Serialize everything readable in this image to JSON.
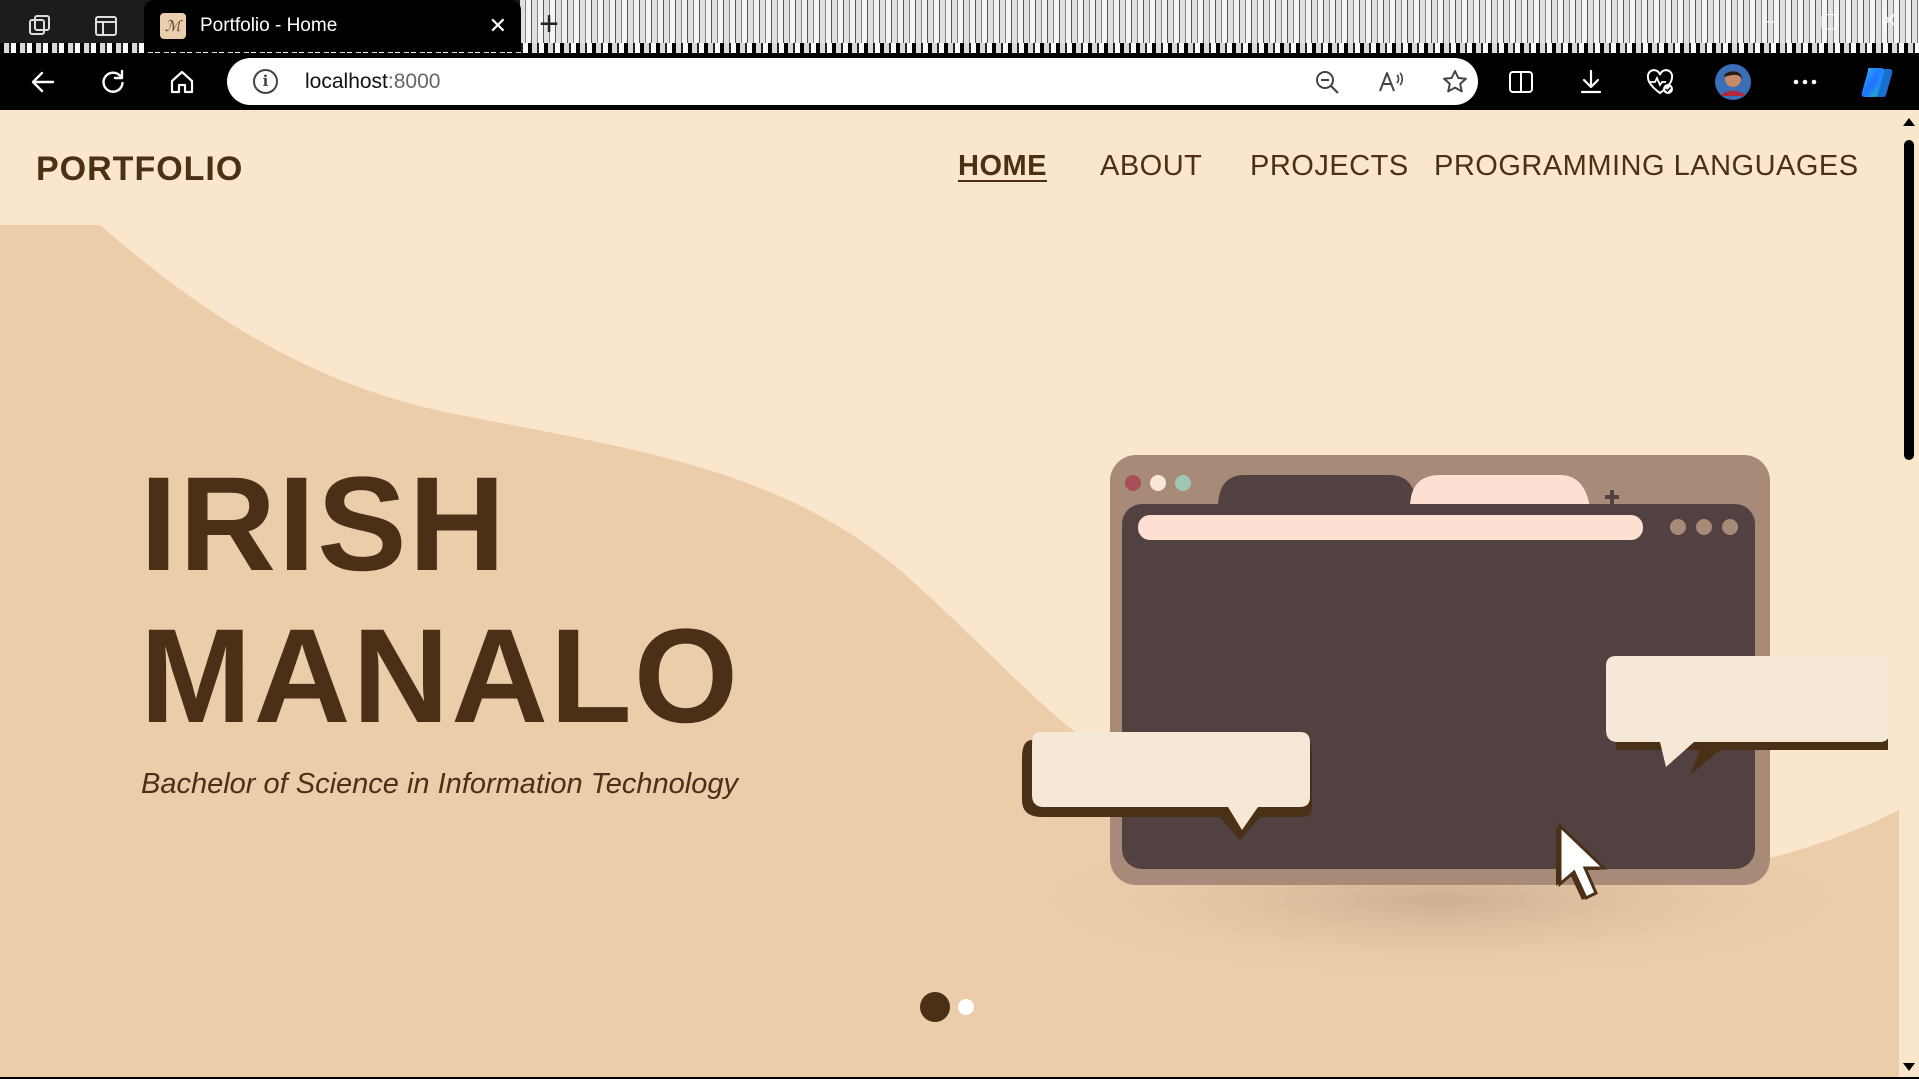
{
  "browser": {
    "tab": {
      "title": "Portfolio - Home",
      "favicon_text": "ℳ"
    },
    "address": {
      "host": "localhost",
      "port": ":8000"
    }
  },
  "site": {
    "logo": "PORTFOLIO",
    "nav": [
      {
        "label": "HOME",
        "active": true
      },
      {
        "label": "ABOUT",
        "active": false
      },
      {
        "label": "PROJECTS",
        "active": false
      },
      {
        "label": "PROGRAMMING LANGUAGES",
        "active": false
      }
    ],
    "hero": {
      "first_name": "IRISH",
      "last_name": "MANALO",
      "subtitle": "Bachelor of Science in Information Technology"
    },
    "carousel": {
      "total_slides": 2,
      "active_slide": 1
    }
  },
  "colors": {
    "brand_brown": "#4a3017",
    "page_bg": "#fae6cc",
    "wave_bg": "#ebcda9",
    "browser_window": "#514140",
    "browser_frame": "#a88a78"
  }
}
